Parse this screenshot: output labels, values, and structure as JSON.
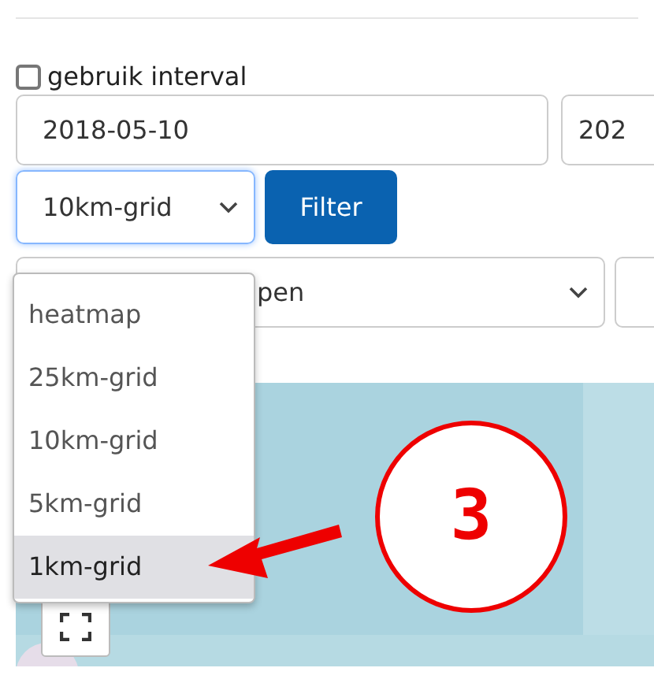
{
  "interval": {
    "label": "gebruik interval",
    "checked": false
  },
  "date_from": {
    "value": "2018-05-10"
  },
  "date_to": {
    "value": "202"
  },
  "layer_select": {
    "value": "10km-grid",
    "expanded": true,
    "options": [
      {
        "label": "heatmap",
        "highlighted": false
      },
      {
        "label": "25km-grid",
        "highlighted": false
      },
      {
        "label": "10km-grid",
        "highlighted": false
      },
      {
        "label": "5km-grid",
        "highlighted": false
      },
      {
        "label": "1km-grid",
        "highlighted": true
      }
    ]
  },
  "filter_button": {
    "label": "Filter"
  },
  "second_select": {
    "value": "pen"
  },
  "annotation": {
    "number": "3"
  }
}
